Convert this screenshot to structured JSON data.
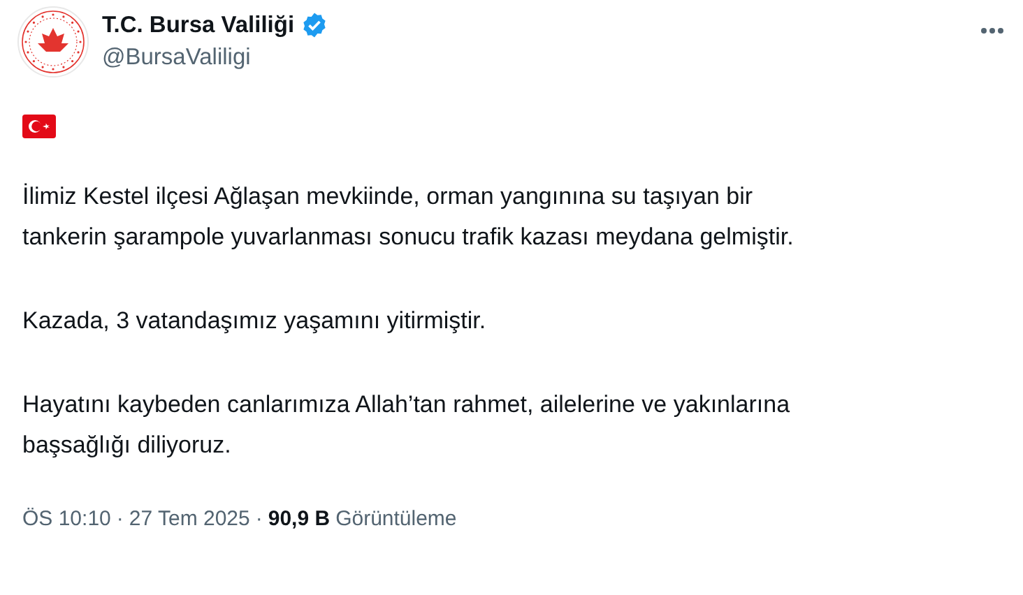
{
  "author": {
    "name": "T.C. Bursa Valiliği",
    "verified": true,
    "handle": "@BursaValiligi"
  },
  "paragraphs": [
    "İlimiz Kestel ilçesi Ağlaşan mevkiinde, orman yangınına su taşıyan bir tankerin şarampole yuvarlanması sonucu trafik kazası meydana gelmiştir.",
    "Kazada, 3 vatandaşımız yaşamını yitirmiştir.",
    "Hayatını kaybeden canlarımıza Allah’tan rahmet, ailelerine ve yakınlarına başsağlığı diliyoruz."
  ],
  "footer": {
    "time": "ÖS 10:10",
    "separator_1": "·",
    "date": "27 Tem 2025",
    "separator_2": "·",
    "views": "90,9 B",
    "views_label": "Görüntüleme"
  }
}
